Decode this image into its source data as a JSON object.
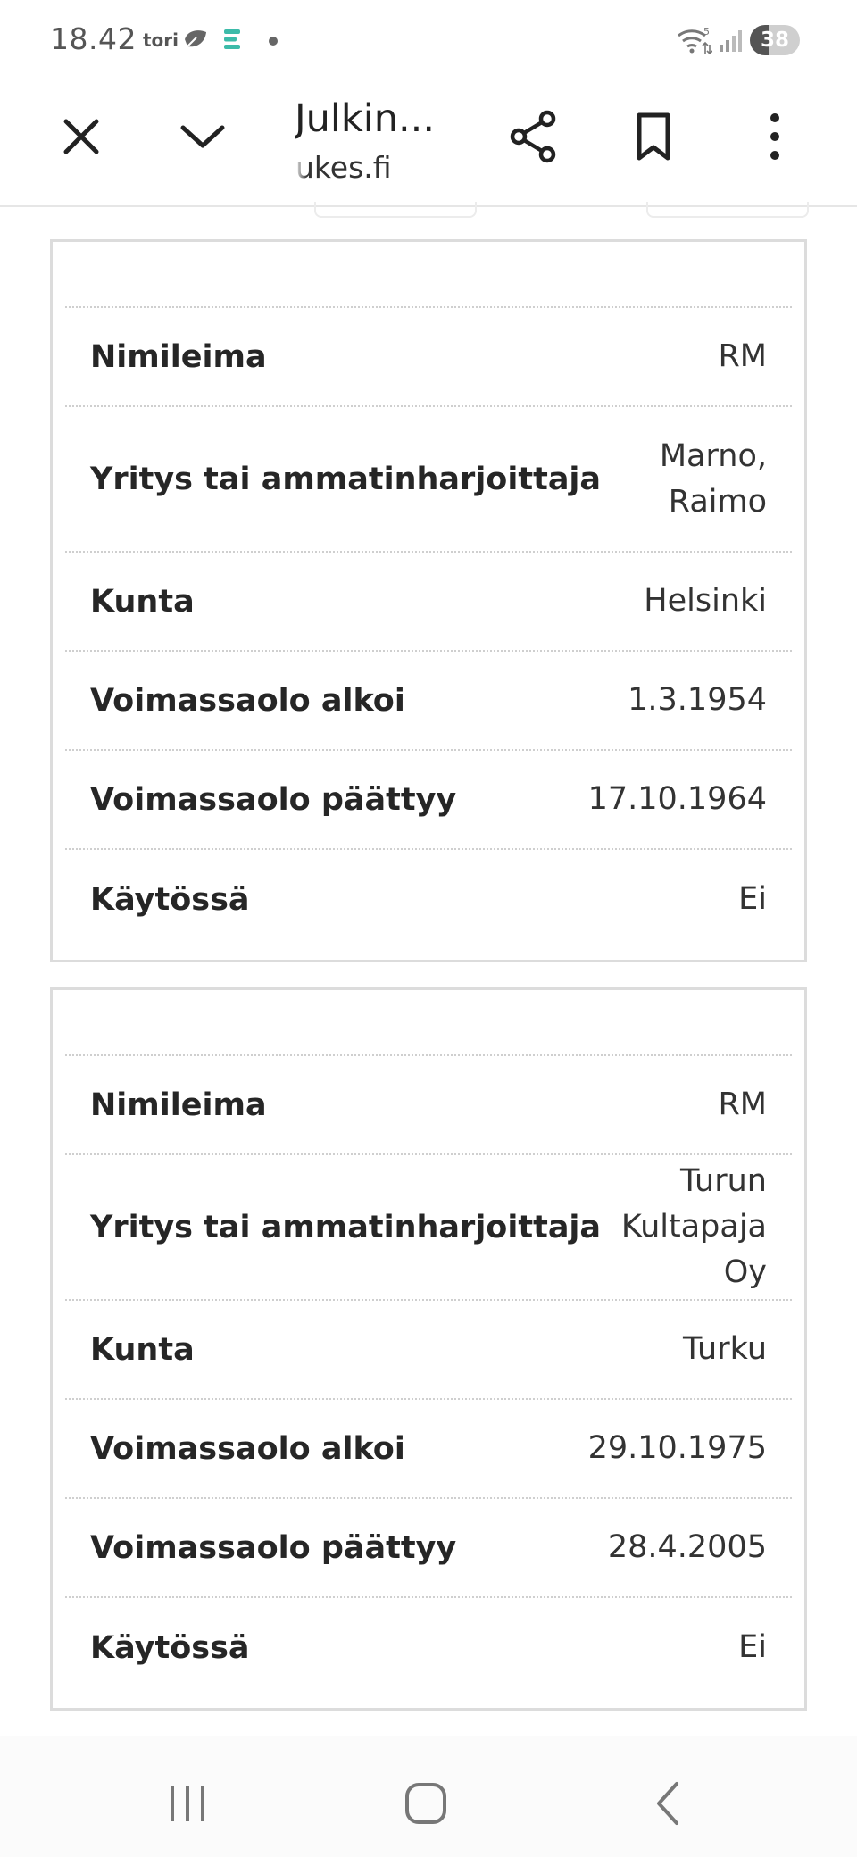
{
  "status_bar": {
    "time": "18.42",
    "app_label": "tori",
    "network_label": "5",
    "battery_level": 0.38,
    "battery_text": "38",
    "icons": [
      "leaf-icon",
      "e-app-icon",
      "notification-dot-icon",
      "wifi-icon",
      "signal-icon",
      "battery-icon"
    ]
  },
  "toolbar": {
    "title": "Julkin...",
    "url": "tukes.fi",
    "icons": [
      "close-icon",
      "chevron-down-icon",
      "share-icon",
      "bookmark-icon",
      "more-vert-icon"
    ]
  },
  "cards": [
    {
      "rows": [
        {
          "label": "Nimileima",
          "value": "RM"
        },
        {
          "label": "Yritys tai ammatinharjoittaja",
          "value": "Marno, Raimo"
        },
        {
          "label": "Kunta",
          "value": "Helsinki"
        },
        {
          "label": "Voimassaolo alkoi",
          "value": "1.3.1954"
        },
        {
          "label": "Voimassaolo päättyy",
          "value": "17.10.1964"
        },
        {
          "label": "Käytössä",
          "value": "Ei"
        }
      ]
    },
    {
      "rows": [
        {
          "label": "Nimileima",
          "value": "RM"
        },
        {
          "label": "Yritys tai ammatinharjoittaja",
          "value": "Turun Kultapaja Oy"
        },
        {
          "label": "Kunta",
          "value": "Turku"
        },
        {
          "label": "Voimassaolo alkoi",
          "value": "29.10.1975"
        },
        {
          "label": "Voimassaolo päättyy",
          "value": "28.4.2005"
        },
        {
          "label": "Käytössä",
          "value": "Ei"
        }
      ]
    }
  ],
  "nav_bar": {
    "icons": [
      "recent-apps-icon",
      "home-icon",
      "back-icon"
    ]
  },
  "colors": {
    "text": "#222222",
    "card_border": "#dcdcdc",
    "divider": "#cfcfcf",
    "background": "#ffffff"
  }
}
